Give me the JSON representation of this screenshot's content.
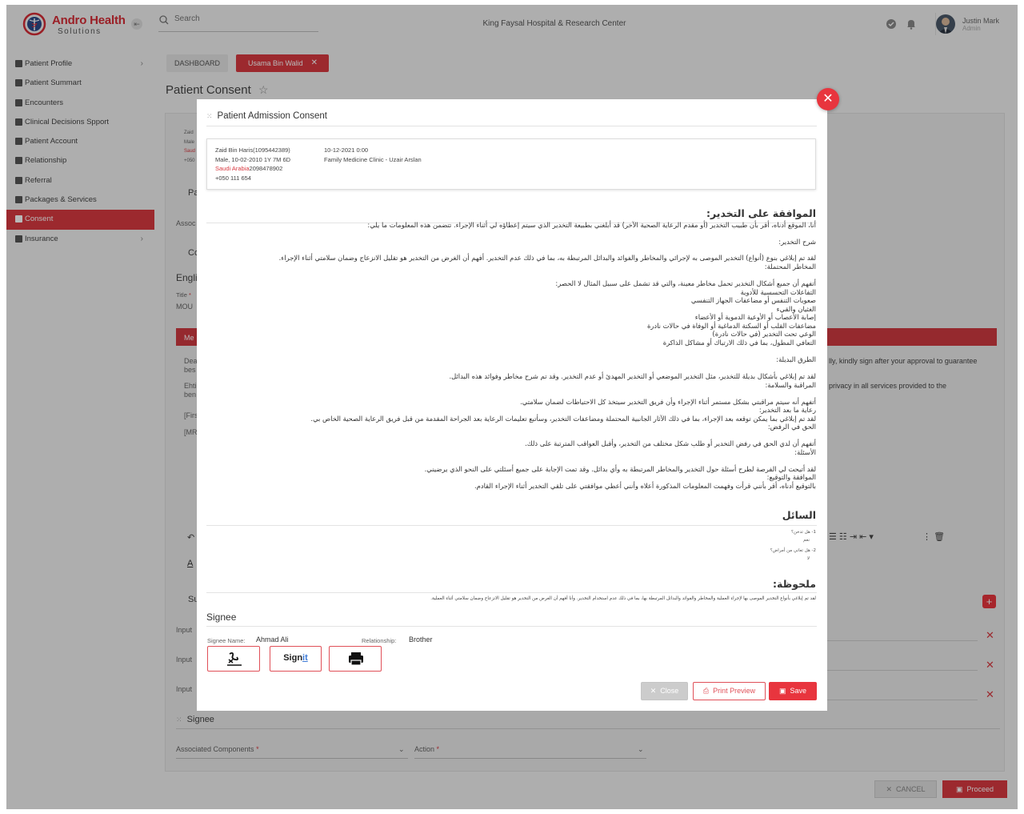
{
  "brand": {
    "name_line1": "Andro Health",
    "name_line2": "Solutions"
  },
  "header": {
    "search_placeholder": "Search",
    "hospital": "King Faysal Hospital & Research Center",
    "user_name": "Justin Mark",
    "user_role": "Admin"
  },
  "sidebar": {
    "items": [
      {
        "label": "Patient Profile",
        "icon": "user-icon",
        "chevron": "›"
      },
      {
        "label": "Patient Summart",
        "icon": "summary-icon",
        "chevron": ""
      },
      {
        "label": "Encounters",
        "icon": "encounters-icon",
        "chevron": ""
      },
      {
        "label": "Clinical Decisions Spport",
        "icon": "plus-box-icon",
        "chevron": ""
      },
      {
        "label": "Patient Account",
        "icon": "account-icon",
        "chevron": ""
      },
      {
        "label": "Relationship",
        "icon": "relationship-icon",
        "chevron": ""
      },
      {
        "label": "Referral",
        "icon": "referral-icon",
        "chevron": ""
      },
      {
        "label": "Packages & Services",
        "icon": "packages-icon",
        "chevron": ""
      },
      {
        "label": "Consent",
        "icon": "consent-icon",
        "chevron": "",
        "active": true
      },
      {
        "label": "Insurance",
        "icon": "insurance-icon",
        "chevron": "›"
      }
    ]
  },
  "breadcrumb": {
    "dashboard": "DASHBOARD",
    "patient_tab": "Usama Bin Walid",
    "tab_close": "✕"
  },
  "page": {
    "title": "Patient Consent"
  },
  "background": {
    "pa_label": "Pa",
    "assoc_label": "Assoc",
    "co_label": "Co",
    "engli_label": "Engli",
    "title_label": "Title",
    "title_req": "*",
    "title_value": "MOU",
    "me_label": "Me",
    "zaid_short": "Zaid",
    "male_short": "Male",
    "saudi_short": "Saud",
    "phone_short": "+050",
    "dea_1": "Dea",
    "dea_2": "bes",
    "ehti_1": "Ehti",
    "ehti_2": "ben",
    "fir": "[Firs",
    "mr": "[MR",
    "right_text_1": "lly, kindly sign after your approval to guarantee",
    "right_text_2": "privacy in all services provided to the",
    "su_label": "Su",
    "input_1": "Input",
    "input_2": "Input",
    "input_3": "Input",
    "signee_label": "Signee",
    "assoc_components": "Associated Components",
    "action": "Action",
    "req": "*",
    "underline_a": "A",
    "cancel": "CANCEL",
    "proceed": "Proceed"
  },
  "modal": {
    "title": "Patient Admission Consent",
    "patient": {
      "name_id": "Zaid Bin Haris(1095442389)",
      "demographics": "Male, 10-02-2010 1Y 7M 6D",
      "country": "Saudi Arabia",
      "nid": "2098478902",
      "phone": "+050 111 654",
      "date": "10-12-2021 0:00",
      "clinic": "Family Medicine Clinic - Uzair Arslan"
    },
    "consent_heading": "الموافقة على التخدير:",
    "consent_lines": [
      "أنا، الموقع أدناه، أقر بأن طبيب التخدير (أو مقدم الرعاية الصحية الآخر) قد أبلغني بطبيعة التخدير الذي سيتم إعطاؤه لي أثناء الإجراء. تتضمن هذه المعلومات ما يلي:",
      "شرح التخدير:",
      "لقد تم إبلاغي بنوع (أنواع) التخدير الموصى به لإجرائي والمخاطر والفوائد والبدائل المرتبطة به، بما في ذلك عدم التخدير. أفهم أن الغرض من التخدير هو تقليل الانزعاج وضمان سلامتي أثناء الإجراء.",
      "المخاطر المحتملة:",
      "أتفهم أن جميع أشكال التخدير تحمل مخاطر معينة، والتي قد تشمل على سبيل المثال لا الحصر:",
      "التفاعلات التحسسية للأدوية",
      "صعوبات التنفس أو مضاعفات الجهاز التنفسي",
      "الغثيان والقيء",
      "إصابة الأعصاب أو الأوعية الدموية أو الأعضاء",
      "مضاعفات القلب أو السكتة الدماغية أو الوفاة في حالات نادرة",
      "الوعي تحت التخدير (في حالات نادرة)",
      "التعافي المطول، بما في ذلك الارتباك أو مشاكل الذاكرة",
      "الطرق البديلة:",
      "لقد تم إبلاغي بأشكال بديلة للتخدير، مثل التخدير الموضعي أو التخدير المهدئ أو عدم التخدير. وقد تم شرح مخاطر وفوائد هذه البدائل.",
      "المراقبة والسلامة:",
      "أتفهم أنه سيتم مراقبتي بشكل مستمر أثناء الإجراء وأن فريق التخدير سيتخذ كل الاحتياطات لضمان سلامتي.",
      "رعاية ما بعد التخدير:",
      "لقد تم إبلاغي بما يمكن توقعه بعد الإجراء، بما في ذلك الآثار الجانبية المحتملة ومضاعفات التخدير، وسأتبع تعليمات الرعاية بعد الجراحة المقدمة من قبل فريق الرعاية الصحية الخاص بي.",
      "الحق في الرفض:",
      "أتفهم أن لدي الحق في رفض التخدير أو طلب شكل مختلف من التخدير، وأقبل العواقب المترتبة على ذلك.",
      "الأسئلة:",
      "لقد أتيحت لي الفرصة لطرح أسئلة حول التخدير والمخاطر المرتبطة به وأي بدائل. وقد تمت الإجابة على جميع أسئلتي على النحو الذي يرضيني.",
      "الموافقة والتوقيع:",
      "بالتوقيع أدناه، أقر بأنني قرأت وفهمت المعلومات المذكورة أعلاه وأنني أعطي موافقتي على تلقي التخدير أثناء الإجراء القادم."
    ],
    "questions_heading": "السائل",
    "questions": [
      {
        "q": "1- هل تدخن؟",
        "a": "نعم"
      },
      {
        "q": "2- هل تعاني من أمراض؟",
        "a": "لا"
      }
    ],
    "note_heading": "ملحوظة:",
    "note_text": "لقد تم إبلاغي بأنواع التخدير الموصى بها لإجراء العملية والمخاطر والفوائد والبدائل المرتبطة بها، بما في ذلك عدم استخدام التخدير. وأنا أفهم أن الغرض من التخدير هو تقليل الانزعاج وضمان سلامتي أثناء العملية.",
    "signee": {
      "heading": "Signee",
      "name_label": "Signee Name:",
      "name_value": "Ahmad Ali",
      "relationship_label": "Relationship:",
      "relationship_value": "Brother",
      "signit": "Sign",
      "signit_it": "it"
    },
    "buttons": {
      "close": "Close",
      "print_preview": "Print Preview",
      "save": "Save"
    }
  },
  "colors": {
    "accent": "#d83a41",
    "modal_close": "#e8353e"
  }
}
